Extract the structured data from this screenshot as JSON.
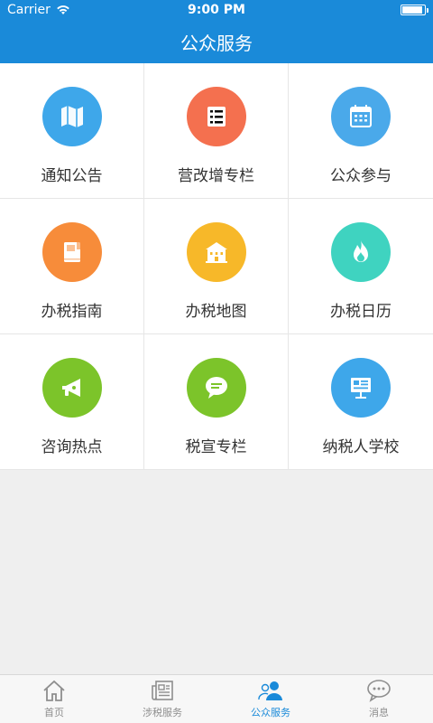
{
  "status_bar": {
    "carrier": "Carrier",
    "time": "9:00 PM"
  },
  "header": {
    "title": "公众服务"
  },
  "grid": [
    {
      "label": "通知公告",
      "icon": "map-icon",
      "color": "#3ea7ea"
    },
    {
      "label": "营改增专栏",
      "icon": "list-icon",
      "color": "#f4704f"
    },
    {
      "label": "公众参与",
      "icon": "calendar-icon",
      "color": "#4aa9ea"
    },
    {
      "label": "办税指南",
      "icon": "book-icon",
      "color": "#f78c3a"
    },
    {
      "label": "办税地图",
      "icon": "building-icon",
      "color": "#f7b829"
    },
    {
      "label": "办税日历",
      "icon": "flame-icon",
      "color": "#3fd3c0"
    },
    {
      "label": "咨询热点",
      "icon": "megaphone-icon",
      "color": "#7cc42a"
    },
    {
      "label": "税宣专栏",
      "icon": "chat-bubble-icon",
      "color": "#7cc42a"
    },
    {
      "label": "纳税人学校",
      "icon": "presentation-board-icon",
      "color": "#3ea7ea"
    }
  ],
  "tabs": [
    {
      "label": "首页",
      "icon": "home-icon",
      "active": false
    },
    {
      "label": "涉税服务",
      "icon": "newspaper-icon",
      "active": false
    },
    {
      "label": "公众服务",
      "icon": "users-icon",
      "active": true
    },
    {
      "label": "消息",
      "icon": "message-icon",
      "active": false
    }
  ],
  "colors": {
    "brand": "#1a8ad9",
    "tab_inactive": "#8e8e8e"
  }
}
